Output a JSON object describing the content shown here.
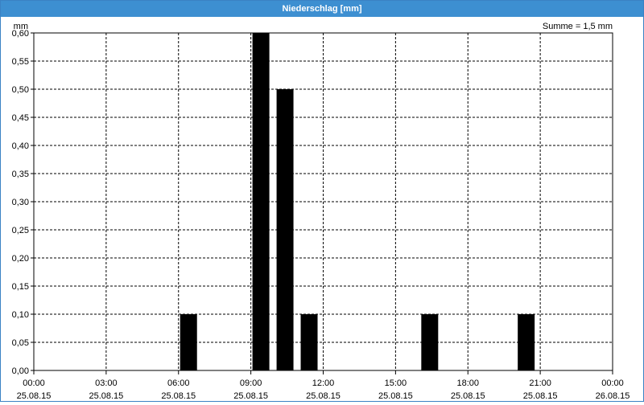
{
  "window": {
    "title": "Niederschlag [mm]"
  },
  "chart_data": {
    "type": "bar",
    "unit_label": "mm",
    "sum_label": "Summe = 1,5 mm",
    "ylim": [
      0,
      0.6
    ],
    "y_ticks": [
      "0,00",
      "0,05",
      "0,10",
      "0,15",
      "0,20",
      "0,25",
      "0,30",
      "0,35",
      "0,40",
      "0,45",
      "0,50",
      "0,55",
      "0,60"
    ],
    "x_range_hours": [
      0,
      24
    ],
    "x_ticks": [
      {
        "time": "00:00",
        "date": "25.08.15"
      },
      {
        "time": "03:00",
        "date": "25.08.15"
      },
      {
        "time": "06:00",
        "date": "25.08.15"
      },
      {
        "time": "09:00",
        "date": "25.08.15"
      },
      {
        "time": "12:00",
        "date": "25.08.15"
      },
      {
        "time": "15:00",
        "date": "25.08.15"
      },
      {
        "time": "18:00",
        "date": "25.08.15"
      },
      {
        "time": "21:00",
        "date": "25.08.15"
      },
      {
        "time": "00:00",
        "date": "26.08.15"
      }
    ],
    "bars": [
      {
        "time": "06:00",
        "value": 0.1
      },
      {
        "time": "09:00",
        "value": 0.6
      },
      {
        "time": "10:00",
        "value": 0.5
      },
      {
        "time": "11:00",
        "value": 0.1
      },
      {
        "time": "16:00",
        "value": 0.1
      },
      {
        "time": "20:00",
        "value": 0.1
      }
    ],
    "bar_color": "#000000",
    "grid": true
  }
}
